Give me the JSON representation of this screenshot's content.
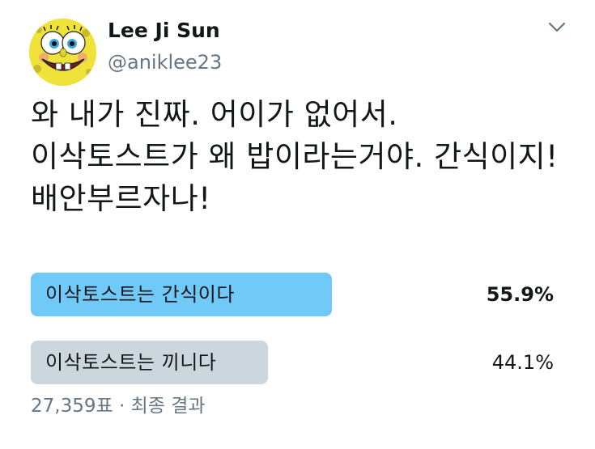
{
  "user": {
    "name": "Lee Ji Sun",
    "handle": "@aniklee23"
  },
  "icons": {
    "avatar": "spongebob-avatar",
    "menu": "chevron-down-icon"
  },
  "tweet": {
    "text": "와 내가 진짜. 어이가 없어서. 이삭토스트가 왜 밥이라는거야. 간식이지! 배안부르자나!"
  },
  "poll": {
    "options": [
      {
        "label": "이삭토스트는 간식이다",
        "percent_text": "55.9%",
        "percent": 55.9,
        "winner": true
      },
      {
        "label": "이삭토스트는 끼니다",
        "percent_text": "44.1%",
        "percent": 44.1,
        "winner": false
      }
    ],
    "votes": "27,359표",
    "separator": "·",
    "status": "최종 결과"
  },
  "colors": {
    "winner_bar": "#71c9f8",
    "loser_bar": "#ccd6dd",
    "secondary_text": "#657786"
  }
}
